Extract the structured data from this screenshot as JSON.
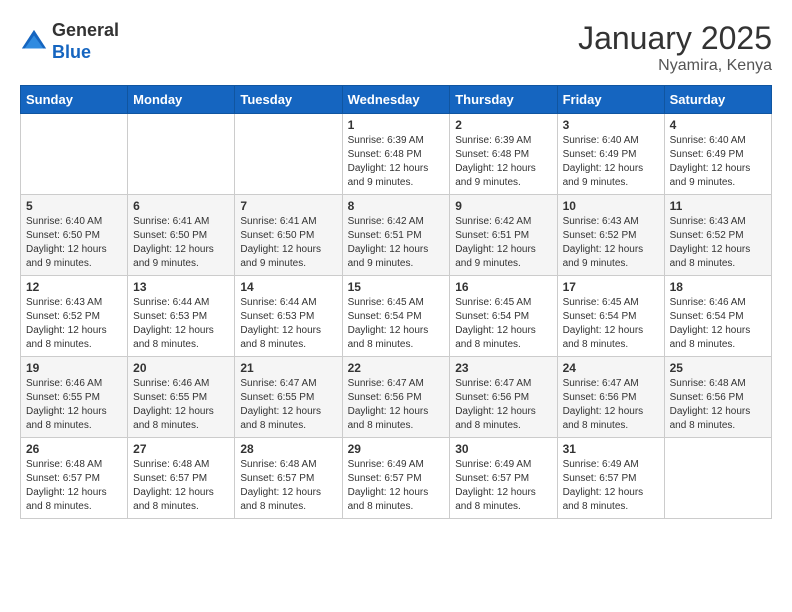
{
  "header": {
    "logo_general": "General",
    "logo_blue": "Blue",
    "month_year": "January 2025",
    "location": "Nyamira, Kenya"
  },
  "weekdays": [
    "Sunday",
    "Monday",
    "Tuesday",
    "Wednesday",
    "Thursday",
    "Friday",
    "Saturday"
  ],
  "weeks": [
    [
      {
        "day": "",
        "info": ""
      },
      {
        "day": "",
        "info": ""
      },
      {
        "day": "",
        "info": ""
      },
      {
        "day": "1",
        "info": "Sunrise: 6:39 AM\nSunset: 6:48 PM\nDaylight: 12 hours and 9 minutes."
      },
      {
        "day": "2",
        "info": "Sunrise: 6:39 AM\nSunset: 6:48 PM\nDaylight: 12 hours and 9 minutes."
      },
      {
        "day": "3",
        "info": "Sunrise: 6:40 AM\nSunset: 6:49 PM\nDaylight: 12 hours and 9 minutes."
      },
      {
        "day": "4",
        "info": "Sunrise: 6:40 AM\nSunset: 6:49 PM\nDaylight: 12 hours and 9 minutes."
      }
    ],
    [
      {
        "day": "5",
        "info": "Sunrise: 6:40 AM\nSunset: 6:50 PM\nDaylight: 12 hours and 9 minutes."
      },
      {
        "day": "6",
        "info": "Sunrise: 6:41 AM\nSunset: 6:50 PM\nDaylight: 12 hours and 9 minutes."
      },
      {
        "day": "7",
        "info": "Sunrise: 6:41 AM\nSunset: 6:50 PM\nDaylight: 12 hours and 9 minutes."
      },
      {
        "day": "8",
        "info": "Sunrise: 6:42 AM\nSunset: 6:51 PM\nDaylight: 12 hours and 9 minutes."
      },
      {
        "day": "9",
        "info": "Sunrise: 6:42 AM\nSunset: 6:51 PM\nDaylight: 12 hours and 9 minutes."
      },
      {
        "day": "10",
        "info": "Sunrise: 6:43 AM\nSunset: 6:52 PM\nDaylight: 12 hours and 9 minutes."
      },
      {
        "day": "11",
        "info": "Sunrise: 6:43 AM\nSunset: 6:52 PM\nDaylight: 12 hours and 8 minutes."
      }
    ],
    [
      {
        "day": "12",
        "info": "Sunrise: 6:43 AM\nSunset: 6:52 PM\nDaylight: 12 hours and 8 minutes."
      },
      {
        "day": "13",
        "info": "Sunrise: 6:44 AM\nSunset: 6:53 PM\nDaylight: 12 hours and 8 minutes."
      },
      {
        "day": "14",
        "info": "Sunrise: 6:44 AM\nSunset: 6:53 PM\nDaylight: 12 hours and 8 minutes."
      },
      {
        "day": "15",
        "info": "Sunrise: 6:45 AM\nSunset: 6:54 PM\nDaylight: 12 hours and 8 minutes."
      },
      {
        "day": "16",
        "info": "Sunrise: 6:45 AM\nSunset: 6:54 PM\nDaylight: 12 hours and 8 minutes."
      },
      {
        "day": "17",
        "info": "Sunrise: 6:45 AM\nSunset: 6:54 PM\nDaylight: 12 hours and 8 minutes."
      },
      {
        "day": "18",
        "info": "Sunrise: 6:46 AM\nSunset: 6:54 PM\nDaylight: 12 hours and 8 minutes."
      }
    ],
    [
      {
        "day": "19",
        "info": "Sunrise: 6:46 AM\nSunset: 6:55 PM\nDaylight: 12 hours and 8 minutes."
      },
      {
        "day": "20",
        "info": "Sunrise: 6:46 AM\nSunset: 6:55 PM\nDaylight: 12 hours and 8 minutes."
      },
      {
        "day": "21",
        "info": "Sunrise: 6:47 AM\nSunset: 6:55 PM\nDaylight: 12 hours and 8 minutes."
      },
      {
        "day": "22",
        "info": "Sunrise: 6:47 AM\nSunset: 6:56 PM\nDaylight: 12 hours and 8 minutes."
      },
      {
        "day": "23",
        "info": "Sunrise: 6:47 AM\nSunset: 6:56 PM\nDaylight: 12 hours and 8 minutes."
      },
      {
        "day": "24",
        "info": "Sunrise: 6:47 AM\nSunset: 6:56 PM\nDaylight: 12 hours and 8 minutes."
      },
      {
        "day": "25",
        "info": "Sunrise: 6:48 AM\nSunset: 6:56 PM\nDaylight: 12 hours and 8 minutes."
      }
    ],
    [
      {
        "day": "26",
        "info": "Sunrise: 6:48 AM\nSunset: 6:57 PM\nDaylight: 12 hours and 8 minutes."
      },
      {
        "day": "27",
        "info": "Sunrise: 6:48 AM\nSunset: 6:57 PM\nDaylight: 12 hours and 8 minutes."
      },
      {
        "day": "28",
        "info": "Sunrise: 6:48 AM\nSunset: 6:57 PM\nDaylight: 12 hours and 8 minutes."
      },
      {
        "day": "29",
        "info": "Sunrise: 6:49 AM\nSunset: 6:57 PM\nDaylight: 12 hours and 8 minutes."
      },
      {
        "day": "30",
        "info": "Sunrise: 6:49 AM\nSunset: 6:57 PM\nDaylight: 12 hours and 8 minutes."
      },
      {
        "day": "31",
        "info": "Sunrise: 6:49 AM\nSunset: 6:57 PM\nDaylight: 12 hours and 8 minutes."
      },
      {
        "day": "",
        "info": ""
      }
    ]
  ]
}
